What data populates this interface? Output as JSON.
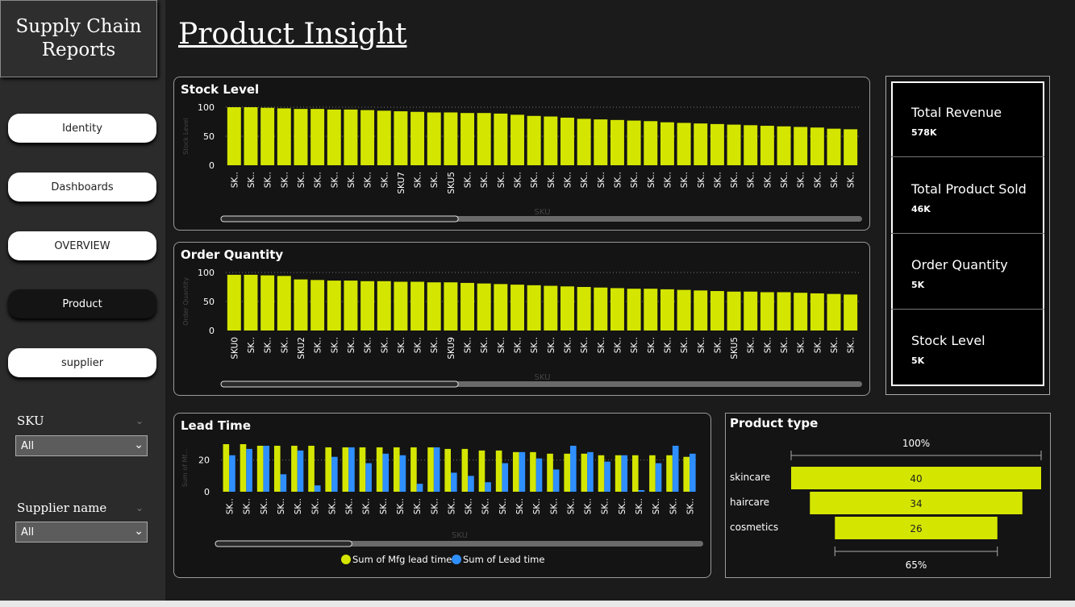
{
  "sidebar": {
    "logo_text": "Supply Chain Reports",
    "nav": [
      {
        "label": "Identity"
      },
      {
        "label": "Dashboards"
      },
      {
        "label": "OVERVIEW"
      },
      {
        "label": "Product"
      },
      {
        "label": "supplier"
      }
    ],
    "slicers": [
      {
        "title": "SKU",
        "value": "All"
      },
      {
        "title": "Supplier name",
        "value": "All"
      }
    ]
  },
  "page_title": "Product Insight",
  "kpis": [
    {
      "label": "Total Revenue",
      "value": "578K"
    },
    {
      "label": "Total Product Sold",
      "value": "46K"
    },
    {
      "label": "Order Quantity",
      "value": "5K"
    },
    {
      "label": "Stock Level",
      "value": "5K"
    }
  ],
  "colors": {
    "accent": "#d4e600",
    "series2": "#2f8fff",
    "card_bg": "#141414"
  },
  "chart_data": [
    {
      "type": "bar",
      "title": "Stock Level",
      "xlabel": "SKU",
      "ylabel": "Stock Level",
      "ylim": [
        0,
        100
      ],
      "yticks": [
        0,
        50,
        100
      ],
      "categories": [
        "SK..",
        "SK..",
        "SK..",
        "SK..",
        "SK..",
        "SK..",
        "SK..",
        "SK..",
        "SK..",
        "SK..",
        "SKU7",
        "SK..",
        "SK..",
        "SKU5",
        "SK..",
        "SK..",
        "SK..",
        "SK..",
        "SK..",
        "SK..",
        "SK..",
        "SK..",
        "SK..",
        "SK..",
        "SK..",
        "SK..",
        "SK..",
        "SK..",
        "SK..",
        "SK..",
        "SK..",
        "SK..",
        "SK..",
        "SK..",
        "SK..",
        "SK..",
        "SK..",
        "SK.."
      ],
      "values": [
        100,
        100,
        99,
        98,
        97,
        97,
        96,
        96,
        95,
        94,
        93,
        92,
        91,
        91,
        90,
        90,
        89,
        87,
        85,
        84,
        82,
        80,
        79,
        78,
        77,
        76,
        74,
        73,
        72,
        71,
        70,
        69,
        68,
        67,
        66,
        65,
        63,
        62
      ],
      "scrollbar": true
    },
    {
      "type": "bar",
      "title": "Order Quantity",
      "xlabel": "SKU",
      "ylabel": "Order Quantity",
      "ylim": [
        0,
        100
      ],
      "yticks": [
        0,
        50,
        100
      ],
      "categories": [
        "SKU0",
        "SK..",
        "SK..",
        "SK..",
        "SKU2",
        "SK..",
        "SK..",
        "SK..",
        "SK..",
        "SK..",
        "SK..",
        "SK..",
        "SK..",
        "SKU9",
        "SK..",
        "SK..",
        "SK..",
        "SK..",
        "SK..",
        "SK..",
        "SK..",
        "SK..",
        "SK..",
        "SK..",
        "SK..",
        "SK..",
        "SK..",
        "SK..",
        "SK..",
        "SK..",
        "SKU5",
        "SK..",
        "SK..",
        "SK..",
        "SK..",
        "SK..",
        "SK..",
        "SK.."
      ],
      "values": [
        96,
        96,
        95,
        94,
        88,
        87,
        86,
        86,
        85,
        85,
        84,
        84,
        83,
        83,
        82,
        81,
        80,
        79,
        78,
        77,
        76,
        75,
        74,
        73,
        72,
        72,
        71,
        70,
        69,
        68,
        67,
        67,
        66,
        66,
        65,
        64,
        63,
        62
      ],
      "scrollbar": true
    },
    {
      "type": "bar",
      "title": "Lead Time",
      "xlabel": "SKU",
      "ylabel": "Sum of Mf...",
      "ylim": [
        0,
        30
      ],
      "yticks": [
        0,
        20
      ],
      "categories": [
        "SK..",
        "SK..",
        "SK..",
        "SK..",
        "SK..",
        "SK..",
        "SK..",
        "SK..",
        "SK..",
        "SK..",
        "SK..",
        "SK..",
        "SK..",
        "SK..",
        "SK..",
        "SK..",
        "SK..",
        "SK..",
        "SK..",
        "SK..",
        "SK..",
        "SK..",
        "SK..",
        "SK..",
        "SK..",
        "SK..",
        "SK..",
        "SK.."
      ],
      "series": [
        {
          "name": "Sum of Mfg lead time",
          "values": [
            30,
            30,
            29,
            29,
            29,
            29,
            28,
            28,
            28,
            28,
            28,
            28,
            28,
            27,
            27,
            26,
            26,
            25,
            25,
            24,
            24,
            24,
            23,
            23,
            23,
            23,
            23,
            22
          ]
        },
        {
          "name": "Sum of Lead time",
          "values": [
            23,
            27,
            29,
            11,
            26,
            4,
            22,
            28,
            18,
            24,
            23,
            5,
            28,
            12,
            10,
            6,
            18,
            25,
            21,
            14,
            29,
            25,
            19,
            23,
            1,
            18,
            29,
            24
          ]
        }
      ],
      "legend": "bottom",
      "scrollbar": true
    },
    {
      "type": "funnel",
      "title": "Product type",
      "categories": [
        "skincare",
        "haircare",
        "cosmetics"
      ],
      "values": [
        40,
        34,
        26
      ],
      "top_label": "100%",
      "bottom_label": "65%"
    }
  ]
}
